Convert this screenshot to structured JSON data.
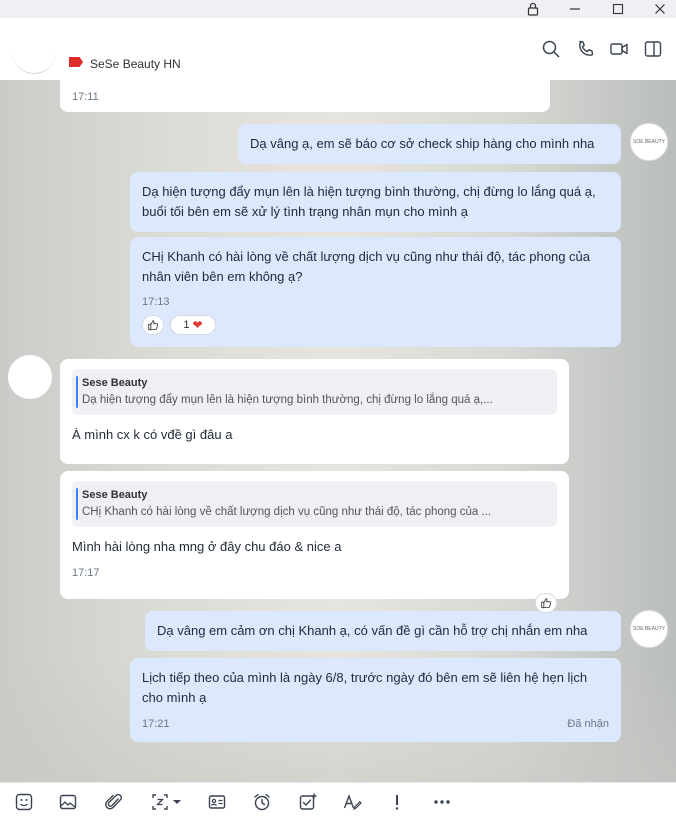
{
  "header": {
    "contact_name": "SeSe Beauty HN",
    "tag_color": "#e02b2b"
  },
  "messages": {
    "m0": {
      "time": "17:11"
    },
    "m1": {
      "text": "Dạ vâng ạ, em sẽ báo cơ sở check ship hàng cho mình nha"
    },
    "m2": {
      "text": "Dạ hiện tượng đẩy mụn lên là hiện tượng bình thường, chị đừng lo lắng quá ạ, buổi tối bên em sẽ xử lý tình trạng nhân mụn cho mình ạ"
    },
    "m3": {
      "text": "CHị Khanh có hài lòng về chất lượng dịch vụ cũng như thái độ, tác phong của nhân viên bên em không ạ?",
      "time": "17:13",
      "reaction_count": "1"
    },
    "m4": {
      "quote_name": "Sese Beauty",
      "quote_text": "Dạ hiện tượng đẩy mụn lên là hiện tượng bình thường, chị đừng lo lắng quá ạ,...",
      "text": "À mình cx k có vđề gì đâu a"
    },
    "m5": {
      "quote_name": "Sese Beauty",
      "quote_text": "CHị Khanh có hài lòng về chất lượng dịch vụ cũng như thái độ, tác phong của ...",
      "text": "Mình hài lòng nha mng ở đây chu đáo & nice a",
      "time": "17:17"
    },
    "m6": {
      "text": "Dạ vâng em cảm ơn chị Khanh ạ, có vấn đề gì cần hỗ trợ chị nhắn em nha"
    },
    "m7": {
      "text": "Lịch tiếp theo của mình là ngày 6/8, trước ngày đó bên em sẽ liên hệ hẹn lịch cho mình ạ",
      "time": "17:21",
      "status": "Đã nhận"
    }
  },
  "avatar_text": "SOE BEAUTY",
  "colors": {
    "my_bubble": "#dbe8fd",
    "their_bubble": "#ffffff",
    "quote_bar": "#3b82f6",
    "heart": "#e53935"
  }
}
